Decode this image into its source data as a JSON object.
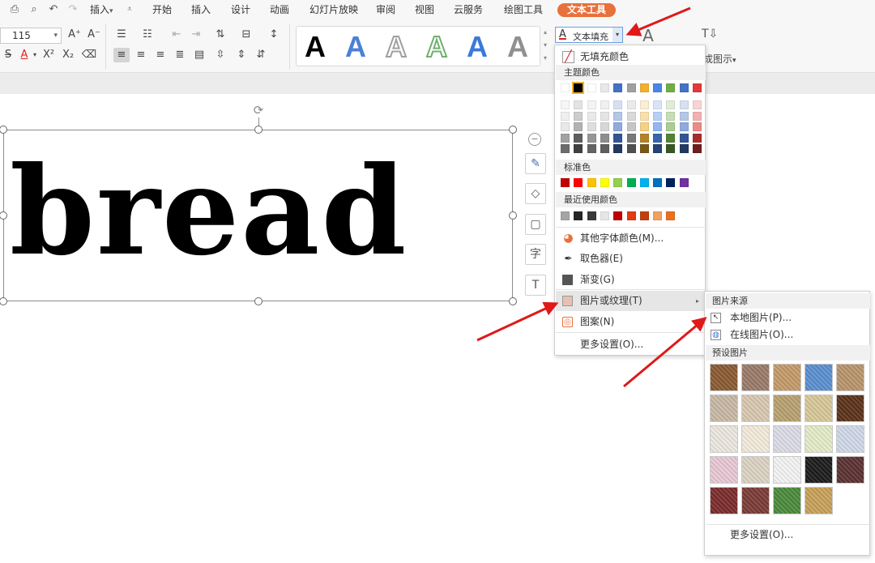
{
  "tabs": [
    {
      "label": "插入",
      "suffix": "▾"
    },
    {
      "label": "开始"
    },
    {
      "label": "插入"
    },
    {
      "label": "设计"
    },
    {
      "label": "动画"
    },
    {
      "label": "幻灯片放映"
    },
    {
      "label": "审阅"
    },
    {
      "label": "视图"
    },
    {
      "label": "云服务"
    },
    {
      "label": "绘图工具"
    },
    {
      "label": "文本工具",
      "active": true
    }
  ],
  "ribbon": {
    "font_size": "115",
    "style_letter": "A",
    "text_fill_label": "文本填充",
    "smartart_label": "成图示",
    "smartart_suffix": "▾"
  },
  "slide": {
    "text": "bread"
  },
  "fill_menu": {
    "no_fill": "无填充颜色",
    "theme_colors_title": "主题颜色",
    "standard_colors_title": "标准色",
    "recent_colors_title": "最近使用颜色",
    "more_colors": "其他字体颜色(M)...",
    "eyedropper": "取色器(E)",
    "gradient": "渐变(G)",
    "picture_texture": "图片或纹理(T)",
    "pattern": "图案(N)",
    "more_settings": "更多设置(O)...",
    "theme_row1": [
      "#ffffff",
      "#000000",
      "#ffffff",
      "#e8e8e8",
      "#4472c4",
      "#a0a0a0",
      "#f0b030",
      "#4a86e8",
      "#70ad47",
      "#4472c4",
      "#e03a3a"
    ],
    "standard_colors": [
      "#c00000",
      "#ff0000",
      "#ffc000",
      "#ffff00",
      "#92d050",
      "#00b050",
      "#00b0f0",
      "#0070c0",
      "#002060",
      "#7030a0"
    ],
    "recent_colors": [
      "#a5a5a5",
      "#262626",
      "#3a3a3a",
      "#e6e6e6",
      "#c00000",
      "#e03c14",
      "#c04010",
      "#f0a060",
      "#e87020"
    ]
  },
  "picture_submenu": {
    "source_title": "图片来源",
    "local_picture": "本地图片(P)...",
    "online_picture": "在线图片(O)...",
    "preset_title": "预设图片",
    "more_settings": "更多设置(O)...",
    "textures": [
      "#8a5a30",
      "#9a7a68",
      "#c49a68",
      "#5a8fd0",
      "#b8946a",
      "#c8b8a4",
      "#d8c8b0",
      "#b8a070",
      "#d8c898",
      "#5a3018",
      "#ece8e0",
      "#f4ecdc",
      "#dcdce8",
      "#e4ecc8",
      "#d0d8e8",
      "#e8c8d4",
      "#dcd4c4",
      "#f4f4f4",
      "#1a1a1a",
      "#5a3030",
      "#7a2a2a",
      "#7a3a34",
      "#4a8a3a",
      "#c8a058"
    ]
  }
}
